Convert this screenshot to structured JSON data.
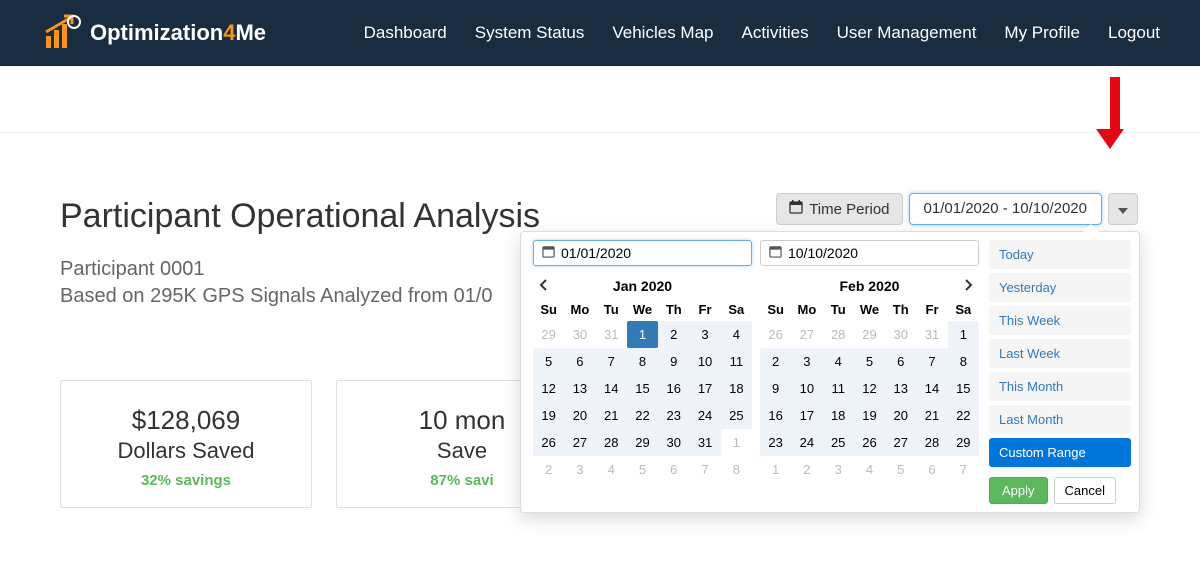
{
  "brand": {
    "part1": "Optimization",
    "part2": "4",
    "part3": "Me"
  },
  "nav": [
    "Dashboard",
    "System Status",
    "Vehicles Map",
    "Activities",
    "User Management",
    "My Profile",
    "Logout"
  ],
  "page": {
    "title": "Participant Operational Analysis",
    "sub1": "Participant 0001",
    "sub2": "Based on 295K GPS Signals Analyzed from 01/0"
  },
  "time_period_label": "Time Period",
  "date_range_display": "01/01/2020 - 10/10/2020",
  "cards": [
    {
      "big": "$128,069",
      "label": "Dollars Saved",
      "sub": "32% savings"
    },
    {
      "big": "10 mon",
      "label": "Save",
      "sub": "87% savi"
    },
    {
      "big": "",
      "label": "",
      "sub": ""
    },
    {
      "big": "",
      "label": "",
      "sub": ""
    }
  ],
  "drp": {
    "start_input": "01/01/2020",
    "end_input": "10/10/2020",
    "left": {
      "title": "Jan 2020",
      "dow": [
        "Su",
        "Mo",
        "Tu",
        "We",
        "Th",
        "Fr",
        "Sa"
      ],
      "rows": [
        [
          {
            "t": "29",
            "c": "muted"
          },
          {
            "t": "30",
            "c": "muted"
          },
          {
            "t": "31",
            "c": "muted"
          },
          {
            "t": "1",
            "c": "sel"
          },
          {
            "t": "2",
            "c": "inrange"
          },
          {
            "t": "3",
            "c": "inrange"
          },
          {
            "t": "4",
            "c": "inrange"
          }
        ],
        [
          {
            "t": "5",
            "c": "inrange"
          },
          {
            "t": "6",
            "c": "inrange"
          },
          {
            "t": "7",
            "c": "inrange"
          },
          {
            "t": "8",
            "c": "inrange"
          },
          {
            "t": "9",
            "c": "inrange"
          },
          {
            "t": "10",
            "c": "inrange"
          },
          {
            "t": "11",
            "c": "inrange"
          }
        ],
        [
          {
            "t": "12",
            "c": "inrange"
          },
          {
            "t": "13",
            "c": "inrange"
          },
          {
            "t": "14",
            "c": "inrange"
          },
          {
            "t": "15",
            "c": "inrange"
          },
          {
            "t": "16",
            "c": "inrange"
          },
          {
            "t": "17",
            "c": "inrange"
          },
          {
            "t": "18",
            "c": "inrange"
          }
        ],
        [
          {
            "t": "19",
            "c": "inrange"
          },
          {
            "t": "20",
            "c": "inrange"
          },
          {
            "t": "21",
            "c": "inrange"
          },
          {
            "t": "22",
            "c": "inrange"
          },
          {
            "t": "23",
            "c": "inrange"
          },
          {
            "t": "24",
            "c": "inrange"
          },
          {
            "t": "25",
            "c": "inrange"
          }
        ],
        [
          {
            "t": "26",
            "c": "inrange"
          },
          {
            "t": "27",
            "c": "inrange"
          },
          {
            "t": "28",
            "c": "inrange"
          },
          {
            "t": "29",
            "c": "inrange"
          },
          {
            "t": "30",
            "c": "inrange"
          },
          {
            "t": "31",
            "c": "inrange"
          },
          {
            "t": "1",
            "c": "muted"
          }
        ],
        [
          {
            "t": "2",
            "c": "muted"
          },
          {
            "t": "3",
            "c": "muted"
          },
          {
            "t": "4",
            "c": "muted"
          },
          {
            "t": "5",
            "c": "muted"
          },
          {
            "t": "6",
            "c": "muted"
          },
          {
            "t": "7",
            "c": "muted"
          },
          {
            "t": "8",
            "c": "muted"
          }
        ]
      ]
    },
    "right": {
      "title": "Feb 2020",
      "dow": [
        "Su",
        "Mo",
        "Tu",
        "We",
        "Th",
        "Fr",
        "Sa"
      ],
      "rows": [
        [
          {
            "t": "26",
            "c": "muted"
          },
          {
            "t": "27",
            "c": "muted"
          },
          {
            "t": "28",
            "c": "muted"
          },
          {
            "t": "29",
            "c": "muted"
          },
          {
            "t": "30",
            "c": "muted"
          },
          {
            "t": "31",
            "c": "muted"
          },
          {
            "t": "1",
            "c": "inrange"
          }
        ],
        [
          {
            "t": "2",
            "c": "inrange"
          },
          {
            "t": "3",
            "c": "inrange"
          },
          {
            "t": "4",
            "c": "inrange"
          },
          {
            "t": "5",
            "c": "inrange"
          },
          {
            "t": "6",
            "c": "inrange"
          },
          {
            "t": "7",
            "c": "inrange"
          },
          {
            "t": "8",
            "c": "inrange"
          }
        ],
        [
          {
            "t": "9",
            "c": "inrange"
          },
          {
            "t": "10",
            "c": "inrange"
          },
          {
            "t": "11",
            "c": "inrange"
          },
          {
            "t": "12",
            "c": "inrange"
          },
          {
            "t": "13",
            "c": "inrange"
          },
          {
            "t": "14",
            "c": "inrange"
          },
          {
            "t": "15",
            "c": "inrange"
          }
        ],
        [
          {
            "t": "16",
            "c": "inrange"
          },
          {
            "t": "17",
            "c": "inrange"
          },
          {
            "t": "18",
            "c": "inrange"
          },
          {
            "t": "19",
            "c": "inrange"
          },
          {
            "t": "20",
            "c": "inrange"
          },
          {
            "t": "21",
            "c": "inrange"
          },
          {
            "t": "22",
            "c": "inrange"
          }
        ],
        [
          {
            "t": "23",
            "c": "inrange"
          },
          {
            "t": "24",
            "c": "inrange"
          },
          {
            "t": "25",
            "c": "inrange"
          },
          {
            "t": "26",
            "c": "inrange"
          },
          {
            "t": "27",
            "c": "inrange"
          },
          {
            "t": "28",
            "c": "inrange"
          },
          {
            "t": "29",
            "c": "inrange"
          }
        ],
        [
          {
            "t": "1",
            "c": "muted"
          },
          {
            "t": "2",
            "c": "muted"
          },
          {
            "t": "3",
            "c": "muted"
          },
          {
            "t": "4",
            "c": "muted"
          },
          {
            "t": "5",
            "c": "muted"
          },
          {
            "t": "6",
            "c": "muted"
          },
          {
            "t": "7",
            "c": "muted"
          }
        ]
      ]
    },
    "presets": [
      "Today",
      "Yesterday",
      "This Week",
      "Last Week",
      "This Month",
      "Last Month",
      "Custom Range"
    ],
    "active_preset_index": 6,
    "apply": "Apply",
    "cancel": "Cancel"
  }
}
